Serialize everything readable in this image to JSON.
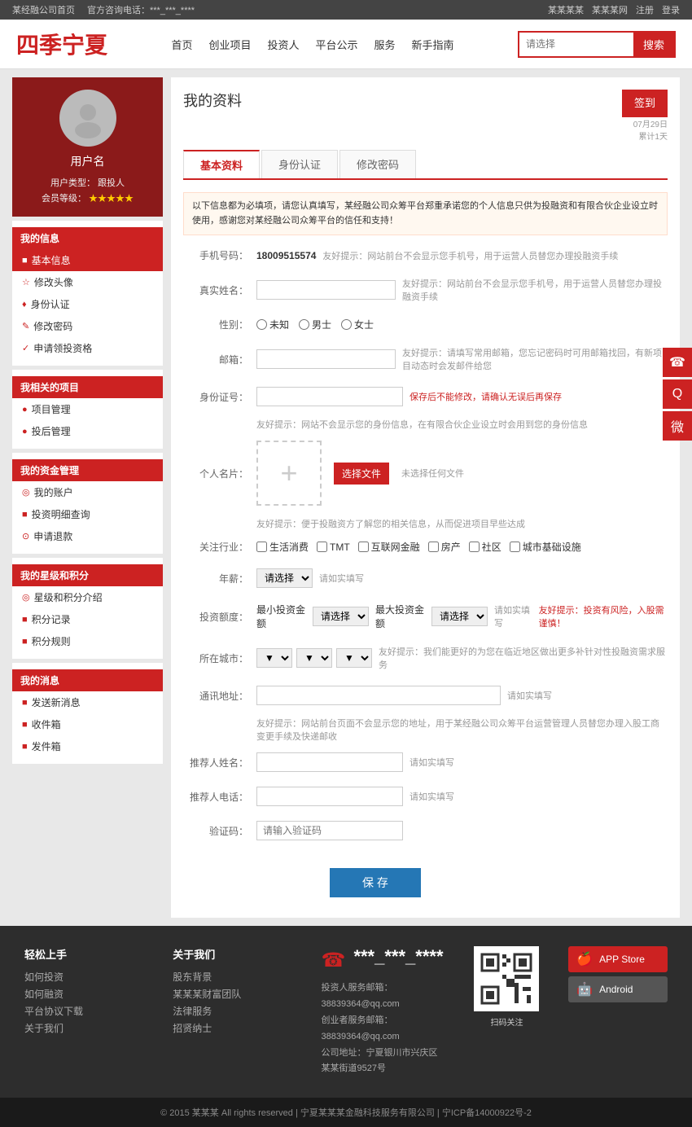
{
  "topBar": {
    "siteName": "某经融公司首页",
    "phone": "官方咨询电话：***_***_****",
    "link1": "某某某某",
    "link2": "某某某网",
    "register": "注册",
    "login": "登录"
  },
  "header": {
    "logo": "四季宁夏",
    "nav": [
      "首页",
      "创业项目",
      "投资人",
      "平台公示",
      "服务",
      "新手指南"
    ],
    "searchPlaceholder": "请选择",
    "searchBtn": "搜索"
  },
  "sidebar": {
    "avatar": "",
    "username": "用户名",
    "userTypeLabel": "用户类型：",
    "userType": "跟投人",
    "levelLabel": "会员等级：",
    "stars": "★★★★★",
    "myInfo": "我的信息",
    "items1": [
      {
        "label": "基本信息",
        "icon": "■",
        "active": true
      },
      {
        "label": "修改头像",
        "icon": "☆"
      },
      {
        "label": "身份认证",
        "icon": "♦"
      },
      {
        "label": "修改密码",
        "icon": "✎"
      },
      {
        "label": "申请领投资格",
        "icon": "✓"
      }
    ],
    "relatedProjects": "我相关的项目",
    "items2": [
      {
        "label": "项目管理",
        "icon": "●"
      },
      {
        "label": "投后管理",
        "icon": "●"
      }
    ],
    "fundMgmt": "我的资金管理",
    "items3": [
      {
        "label": "我的账户",
        "icon": "◎"
      },
      {
        "label": "投资明细查询",
        "icon": "■"
      },
      {
        "label": "申请退款",
        "icon": "⊙"
      }
    ],
    "levelSection": "我的星级和积分",
    "items4": [
      {
        "label": "星级和积分介绍",
        "icon": "◎"
      },
      {
        "label": "积分记录",
        "icon": "■"
      },
      {
        "label": "积分规则",
        "icon": "■"
      }
    ],
    "messages": "我的消息",
    "items5": [
      {
        "label": "发送新消息",
        "icon": "■"
      },
      {
        "label": "收件箱",
        "icon": "■"
      },
      {
        "label": "发件箱",
        "icon": "■"
      }
    ]
  },
  "content": {
    "title": "我的资料",
    "signinBtn": "签到",
    "signinDate": "07月29日",
    "signinDays": "累计1天",
    "tabs": [
      "基本资料",
      "身份认证",
      "修改密码"
    ],
    "notice": "以下信息都为必填项，请您认真填写，某经融公司众筹平台郑重承诺您的个人信息只供为投融资和有限合伙企业设立时使用，感谢您对某经融公司众筹平台的信任和支持！",
    "phoneLabel": "手机号码：",
    "phoneValue": "18009515574",
    "phoneHint": "友好提示：网站前台不会显示您手机号，用于运营人员替您办理投融资手续",
    "realNameLabel": "真实姓名：",
    "realNameHint": "友好提示：网站前台不会显示您手机号，用于运营人员替您办理投融资手续",
    "genderLabel": "性别：",
    "genderOptions": [
      "未知",
      "男士",
      "女士"
    ],
    "emailLabel": "邮箱：",
    "emailHint": "友好提示：请填写常用邮箱，您忘记密码时可用邮箱找回，有新项目动态时会发邮件给您",
    "idLabel": "身份证号：",
    "idWarn": "保存后不能修改，请确认无误后再保存",
    "idHint": "友好提示：网站不会显示您的身份信息，在有限合伙企业设立时会用到您的身份信息",
    "photoLabel": "个人名片：",
    "selectFileBtn": "选择文件",
    "noFileText": "未选择任何文件",
    "photoHint": "友好提示：便于投融资方了解您的相关信息，从而促进项目早些达成",
    "industryLabel": "关注行业：",
    "industryOptions": [
      "生活消费",
      "TMT",
      "互联网金融",
      "房产",
      "社区",
      "城市基础设施"
    ],
    "salaryLabel": "年薪：",
    "salaryPlaceholder": "请选择",
    "salaryHint": "请如实填写",
    "investLabel": "投资额度：",
    "minInvestLabel": "最小投资金额",
    "minInvestPlaceholder": "请选择",
    "maxInvestLabel": "最大投资金额",
    "maxInvestPlaceholder": "请选择",
    "investHint": "请如实填写",
    "investWarn": "友好提示：投资有风险，入股需谨慎！",
    "cityLabel": "所在城市：",
    "cityHint": "友好提示：我们能更好的为您在临近地区做出更多补针对性投融资需求服务",
    "contactLabel": "通讯地址：",
    "contactHint": "请如实填写",
    "contactHint2": "友好提示：网站前台页面不会显示您的地址，用于某经融公司众筹平台运营管理人员替您办理入股工商变更手续及快递邮收",
    "referrerLabel": "推荐人姓名：",
    "referrerHint": "请如实填写",
    "referrerPhoneLabel": "推荐人电话：",
    "referrerPhoneHint": "请如实填写",
    "captchaLabel": "验证码：",
    "captchaPlaceholder": "请输入验证码",
    "saveBtn": "保  存"
  },
  "footer": {
    "col1Title": "轻松上手",
    "col1Links": [
      "如何投资",
      "如何融资",
      "平台协议下载",
      "关于我们"
    ],
    "col2Title": "关于我们",
    "col2Links": [
      "股东背景",
      "某某某财富团队",
      "法律服务",
      "招贤纳士"
    ],
    "phone": "***_***_****",
    "emailService": "投资人服务邮箱：38839364@qq.com",
    "emailBiz": "创业者服务邮箱：38839364@qq.com",
    "address": "公司地址：宁夏银川市兴庆区某某街道9527号",
    "phoneIcon": "☎",
    "appStore": "APP Store",
    "android": "Android",
    "copyright": "© 2015 某某某 All rights reserved | 宁夏某某某金融科技服务有限公司 | 宁ICP备14000922号-2"
  },
  "floatBtns": [
    "☎",
    "💬",
    "💬"
  ]
}
